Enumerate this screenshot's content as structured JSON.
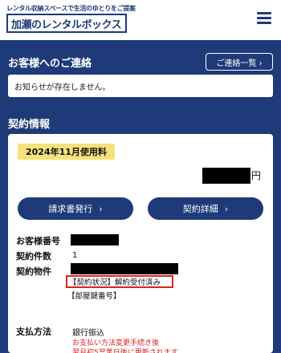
{
  "header": {
    "tagline": "レンタル収納スペースで生活のゆとりをご提案",
    "brand": "加瀬のレンタルボックス"
  },
  "notice_section": {
    "title": "お客様へのご連絡",
    "button_label": "ご連絡一覧 ›",
    "message": "お知らせが存在しません。"
  },
  "contract_section": {
    "title": "契約情報",
    "fee_badge": "2024年11月使用料",
    "amount_value": "",
    "amount_unit": "円",
    "invoice_button": "請求書発行",
    "detail_button": "契約詳細",
    "chevron": "›",
    "fields": {
      "customer_no_label": "お客様番号",
      "customer_no_value": "",
      "count_label": "契約件数",
      "count_value": "1",
      "property_label": "契約物件",
      "property_value": "",
      "status_text": "【契約状況】解約受付済み",
      "room_text": "【部屋鍵番号】",
      "payment_label": "支払方法",
      "payment_value": "銀行振込",
      "payment_note_1": "お支払い方法変更手続き後",
      "payment_note_2": "翌月初5営業日後に更新されます。"
    }
  },
  "colors": {
    "navy": "#1f3a78",
    "badge_yellow": "#f5e27a",
    "alert_red": "#d22"
  }
}
